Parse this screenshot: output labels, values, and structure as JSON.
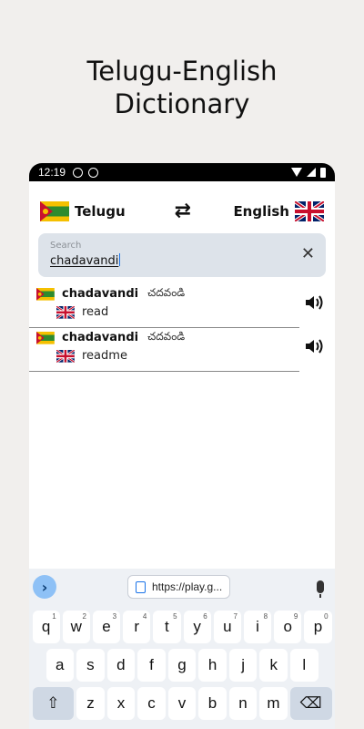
{
  "promo": {
    "title_line1": "Telugu-English",
    "title_line2": "Dictionary"
  },
  "status_bar": {
    "time": "12:19"
  },
  "lang_bar": {
    "source_label": "Telugu",
    "target_label": "English",
    "swap_icon": "swap-arrows-icon"
  },
  "search": {
    "placeholder": "Search",
    "value": "chadavandi"
  },
  "results": [
    {
      "word": "chadavandi",
      "telugu": "చదవండి",
      "english": "read"
    },
    {
      "word": "chadavandi",
      "telugu": "చదవండి",
      "english": "readme"
    }
  ],
  "keyboard": {
    "url_chip": "https://play.g...",
    "row1": [
      {
        "k": "q",
        "n": "1"
      },
      {
        "k": "w",
        "n": "2"
      },
      {
        "k": "e",
        "n": "3"
      },
      {
        "k": "r",
        "n": "4"
      },
      {
        "k": "t",
        "n": "5"
      },
      {
        "k": "y",
        "n": "6"
      },
      {
        "k": "u",
        "n": "7"
      },
      {
        "k": "i",
        "n": "8"
      },
      {
        "k": "o",
        "n": "9"
      },
      {
        "k": "p",
        "n": "0"
      }
    ],
    "row2": [
      "a",
      "s",
      "d",
      "f",
      "g",
      "h",
      "j",
      "k",
      "l"
    ],
    "row3": [
      "z",
      "x",
      "c",
      "v",
      "b",
      "n",
      "m"
    ],
    "shift_icon": "shift-icon",
    "backspace_icon": "backspace-icon"
  },
  "colors": {
    "search_bg": "#dde3ea",
    "keyboard_bg": "#eef1f5",
    "accent": "#1a73e8"
  }
}
